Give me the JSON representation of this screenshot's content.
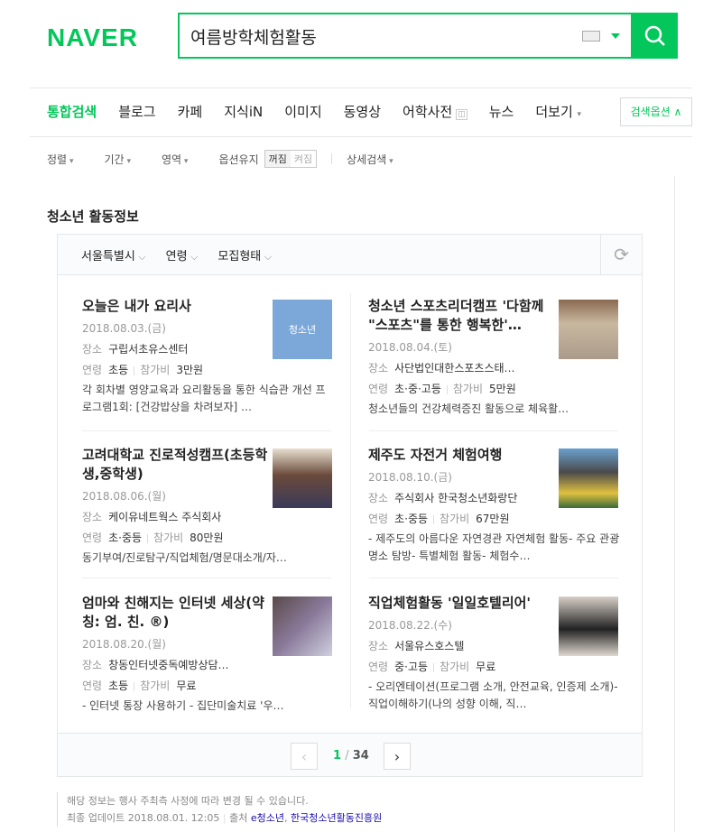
{
  "logo": "NAVER",
  "search": {
    "value": "여름방학체험활동"
  },
  "tabs": [
    "통합검색",
    "블로그",
    "카페",
    "지식iN",
    "이미지",
    "동영상",
    "어학사전",
    "뉴스",
    "더보기"
  ],
  "search_option": "검색옵션",
  "filters": {
    "sort": "정렬",
    "period": "기간",
    "area": "영역",
    "keep": "옵션유지",
    "off": "꺼짐",
    "on": "켜짐",
    "detail": "상세검색"
  },
  "section_title": "청소년 활동정보",
  "panel_filters": [
    "서울특별시",
    "연령",
    "모집형태"
  ],
  "cards": [
    {
      "title": "오늘은 내가 요리사",
      "date": "2018.08.03.(금)",
      "place_label": "장소",
      "place": "구립서초유스센터",
      "age_label": "연령",
      "age": "초등",
      "fee_label": "참가비",
      "fee": "3만원",
      "desc": "각 회차별 영양교육과 요리활동을 통한 식습관 개선 프로그램1회: [건강밥상을 차려보자] …"
    },
    {
      "title": "청소년 스포츠리더캠프 '다함께 \"스포츠\"를 통한 행복한'…",
      "date": "2018.08.04.(토)",
      "place_label": "장소",
      "place": "사단법인대한스포츠스태…",
      "age_label": "연령",
      "age": "초·중·고등",
      "fee_label": "참가비",
      "fee": "5만원",
      "desc": "청소년들의 건강체력증진 활동으로 체육활…"
    },
    {
      "title": "고려대학교 진로적성캠프(초등학생,중학생)",
      "date": "2018.08.06.(월)",
      "place_label": "장소",
      "place": "케이유네트웍스 주식회사",
      "age_label": "연령",
      "age": "초·중등",
      "fee_label": "참가비",
      "fee": "80만원",
      "desc": "동기부여/진로탐구/직업체험/명문대소개/자…"
    },
    {
      "title": "제주도 자전거 체험여행",
      "date": "2018.08.10.(금)",
      "place_label": "장소",
      "place": "주식회사 한국청소년화랑단",
      "age_label": "연령",
      "age": "초·중등",
      "fee_label": "참가비",
      "fee": "67만원",
      "desc": "- 제주도의 아름다운 자연경관 자연체험 활동- 주요 관광명소 탐방- 특별체험 활동- 체험수…"
    },
    {
      "title": "엄마와 친해지는 인터넷 세상(약칭: 엄. 친. ®)",
      "date": "2018.08.20.(월)",
      "place_label": "장소",
      "place": "창동인터넷중독예방상담…",
      "age_label": "연령",
      "age": "초등",
      "fee_label": "참가비",
      "fee": "무료",
      "desc": "- 인터넷 통장 사용하기 - 집단미술치료 '우…"
    },
    {
      "title": "직업체험활동 '일일호텔리어'",
      "date": "2018.08.22.(수)",
      "place_label": "장소",
      "place": "서울유스호스텔",
      "age_label": "연령",
      "age": "중·고등",
      "fee_label": "참가비",
      "fee": "무료",
      "desc": "- 오리엔테이션(프로그램 소개, 안전교육, 인증제 소개)- 직업이해하기(나의 성향 이해, 직…"
    }
  ],
  "thumb1_text": "청소년",
  "pagination": {
    "current": "1",
    "sep": "/",
    "total": "34"
  },
  "note": {
    "line1": "해당 정보는 행사 주최측 사정에 따라 변경 될 수 있습니다.",
    "update": "최종 업데이트 2018.08.01. 12:05",
    "source_label": "출처",
    "src1": "e청소년",
    "src2": "한국청소년활동진흥원"
  },
  "colors": {
    "brand": "#03c75a"
  }
}
